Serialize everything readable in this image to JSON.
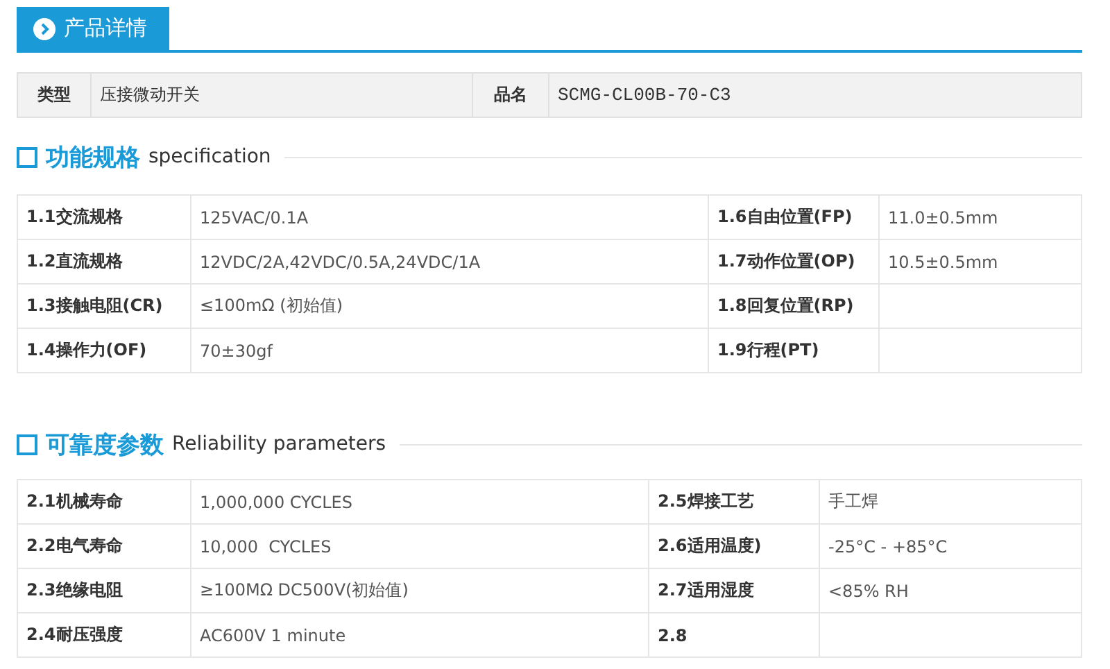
{
  "tab": {
    "label": "产品详情"
  },
  "info": [
    {
      "label": "类型",
      "value": "压接微动开关"
    },
    {
      "label": "品名",
      "value": "SCMG-CL00B-70-C3"
    }
  ],
  "sections": [
    {
      "title": "功能规格",
      "subtitle": "specification",
      "rows": [
        [
          {
            "label": "1.1交流规格",
            "value": "125VAC/0.1A"
          },
          {
            "label": "1.6自由位置(FP)",
            "value": "11.0±0.5mm"
          }
        ],
        [
          {
            "label": "1.2直流规格",
            "value": "12VDC/2A,42VDC/0.5A,24VDC/1A"
          },
          {
            "label": "1.7动作位置(OP)",
            "value": "10.5±0.5mm"
          }
        ],
        [
          {
            "label": "1.3接触电阻(CR)",
            "value": "≤100mΩ (初始值)"
          },
          {
            "label": "1.8回复位置(RP)"
          }
        ],
        [
          {
            "label": "1.4操作力(OF)",
            "value": "70±30gf"
          },
          {
            "label": "1.9行程(PT)"
          }
        ]
      ]
    },
    {
      "title": "可靠度参数",
      "subtitle": "Reliability parameters",
      "rows": [
        [
          {
            "label": "2.1机械寿命",
            "value": "1,000,000 CYCLES"
          },
          {
            "label": "2.5焊接工艺",
            "value": "手工焊"
          }
        ],
        [
          {
            "label": "2.2电气寿命",
            "value": "10,000  CYCLES"
          },
          {
            "label": "2.6适用温度)",
            "value": "-25°C - +85°C"
          }
        ],
        [
          {
            "label": "2.3绝缘电阻",
            "value": "≥100MΩ DC500V(初始值)"
          },
          {
            "label": "2.7适用湿度",
            "value": "<85% RH"
          }
        ],
        [
          {
            "label": "2.4耐压强度",
            "value": "AC600V 1 minute"
          },
          {
            "label": "2.8"
          }
        ]
      ]
    }
  ]
}
